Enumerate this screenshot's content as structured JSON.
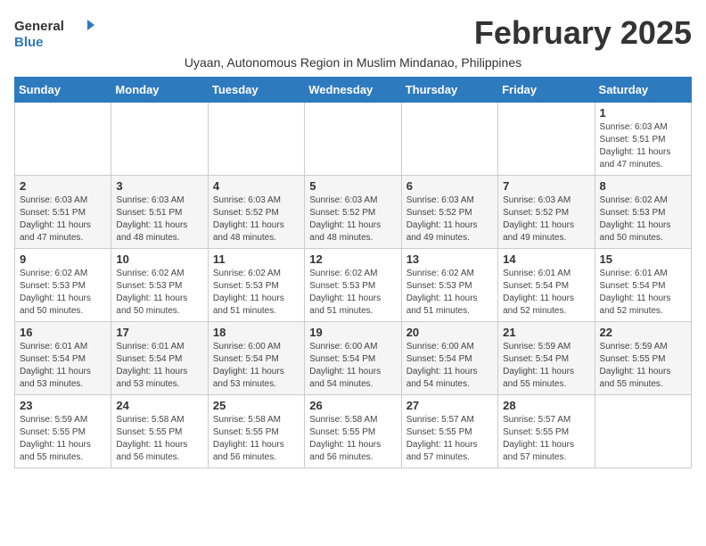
{
  "header": {
    "logo_general": "General",
    "logo_blue": "Blue",
    "month_title": "February 2025",
    "subtitle": "Uyaan, Autonomous Region in Muslim Mindanao, Philippines"
  },
  "weekdays": [
    "Sunday",
    "Monday",
    "Tuesday",
    "Wednesday",
    "Thursday",
    "Friday",
    "Saturday"
  ],
  "weeks": [
    [
      {
        "day": "",
        "sunrise": "",
        "sunset": "",
        "daylight": ""
      },
      {
        "day": "",
        "sunrise": "",
        "sunset": "",
        "daylight": ""
      },
      {
        "day": "",
        "sunrise": "",
        "sunset": "",
        "daylight": ""
      },
      {
        "day": "",
        "sunrise": "",
        "sunset": "",
        "daylight": ""
      },
      {
        "day": "",
        "sunrise": "",
        "sunset": "",
        "daylight": ""
      },
      {
        "day": "",
        "sunrise": "",
        "sunset": "",
        "daylight": ""
      },
      {
        "day": "1",
        "sunrise": "Sunrise: 6:03 AM",
        "sunset": "Sunset: 5:51 PM",
        "daylight": "Daylight: 11 hours and 47 minutes."
      }
    ],
    [
      {
        "day": "2",
        "sunrise": "Sunrise: 6:03 AM",
        "sunset": "Sunset: 5:51 PM",
        "daylight": "Daylight: 11 hours and 47 minutes."
      },
      {
        "day": "3",
        "sunrise": "Sunrise: 6:03 AM",
        "sunset": "Sunset: 5:51 PM",
        "daylight": "Daylight: 11 hours and 48 minutes."
      },
      {
        "day": "4",
        "sunrise": "Sunrise: 6:03 AM",
        "sunset": "Sunset: 5:52 PM",
        "daylight": "Daylight: 11 hours and 48 minutes."
      },
      {
        "day": "5",
        "sunrise": "Sunrise: 6:03 AM",
        "sunset": "Sunset: 5:52 PM",
        "daylight": "Daylight: 11 hours and 48 minutes."
      },
      {
        "day": "6",
        "sunrise": "Sunrise: 6:03 AM",
        "sunset": "Sunset: 5:52 PM",
        "daylight": "Daylight: 11 hours and 49 minutes."
      },
      {
        "day": "7",
        "sunrise": "Sunrise: 6:03 AM",
        "sunset": "Sunset: 5:52 PM",
        "daylight": "Daylight: 11 hours and 49 minutes."
      },
      {
        "day": "8",
        "sunrise": "Sunrise: 6:02 AM",
        "sunset": "Sunset: 5:53 PM",
        "daylight": "Daylight: 11 hours and 50 minutes."
      }
    ],
    [
      {
        "day": "9",
        "sunrise": "Sunrise: 6:02 AM",
        "sunset": "Sunset: 5:53 PM",
        "daylight": "Daylight: 11 hours and 50 minutes."
      },
      {
        "day": "10",
        "sunrise": "Sunrise: 6:02 AM",
        "sunset": "Sunset: 5:53 PM",
        "daylight": "Daylight: 11 hours and 50 minutes."
      },
      {
        "day": "11",
        "sunrise": "Sunrise: 6:02 AM",
        "sunset": "Sunset: 5:53 PM",
        "daylight": "Daylight: 11 hours and 51 minutes."
      },
      {
        "day": "12",
        "sunrise": "Sunrise: 6:02 AM",
        "sunset": "Sunset: 5:53 PM",
        "daylight": "Daylight: 11 hours and 51 minutes."
      },
      {
        "day": "13",
        "sunrise": "Sunrise: 6:02 AM",
        "sunset": "Sunset: 5:53 PM",
        "daylight": "Daylight: 11 hours and 51 minutes."
      },
      {
        "day": "14",
        "sunrise": "Sunrise: 6:01 AM",
        "sunset": "Sunset: 5:54 PM",
        "daylight": "Daylight: 11 hours and 52 minutes."
      },
      {
        "day": "15",
        "sunrise": "Sunrise: 6:01 AM",
        "sunset": "Sunset: 5:54 PM",
        "daylight": "Daylight: 11 hours and 52 minutes."
      }
    ],
    [
      {
        "day": "16",
        "sunrise": "Sunrise: 6:01 AM",
        "sunset": "Sunset: 5:54 PM",
        "daylight": "Daylight: 11 hours and 53 minutes."
      },
      {
        "day": "17",
        "sunrise": "Sunrise: 6:01 AM",
        "sunset": "Sunset: 5:54 PM",
        "daylight": "Daylight: 11 hours and 53 minutes."
      },
      {
        "day": "18",
        "sunrise": "Sunrise: 6:00 AM",
        "sunset": "Sunset: 5:54 PM",
        "daylight": "Daylight: 11 hours and 53 minutes."
      },
      {
        "day": "19",
        "sunrise": "Sunrise: 6:00 AM",
        "sunset": "Sunset: 5:54 PM",
        "daylight": "Daylight: 11 hours and 54 minutes."
      },
      {
        "day": "20",
        "sunrise": "Sunrise: 6:00 AM",
        "sunset": "Sunset: 5:54 PM",
        "daylight": "Daylight: 11 hours and 54 minutes."
      },
      {
        "day": "21",
        "sunrise": "Sunrise: 5:59 AM",
        "sunset": "Sunset: 5:54 PM",
        "daylight": "Daylight: 11 hours and 55 minutes."
      },
      {
        "day": "22",
        "sunrise": "Sunrise: 5:59 AM",
        "sunset": "Sunset: 5:55 PM",
        "daylight": "Daylight: 11 hours and 55 minutes."
      }
    ],
    [
      {
        "day": "23",
        "sunrise": "Sunrise: 5:59 AM",
        "sunset": "Sunset: 5:55 PM",
        "daylight": "Daylight: 11 hours and 55 minutes."
      },
      {
        "day": "24",
        "sunrise": "Sunrise: 5:58 AM",
        "sunset": "Sunset: 5:55 PM",
        "daylight": "Daylight: 11 hours and 56 minutes."
      },
      {
        "day": "25",
        "sunrise": "Sunrise: 5:58 AM",
        "sunset": "Sunset: 5:55 PM",
        "daylight": "Daylight: 11 hours and 56 minutes."
      },
      {
        "day": "26",
        "sunrise": "Sunrise: 5:58 AM",
        "sunset": "Sunset: 5:55 PM",
        "daylight": "Daylight: 11 hours and 56 minutes."
      },
      {
        "day": "27",
        "sunrise": "Sunrise: 5:57 AM",
        "sunset": "Sunset: 5:55 PM",
        "daylight": "Daylight: 11 hours and 57 minutes."
      },
      {
        "day": "28",
        "sunrise": "Sunrise: 5:57 AM",
        "sunset": "Sunset: 5:55 PM",
        "daylight": "Daylight: 11 hours and 57 minutes."
      },
      {
        "day": "",
        "sunrise": "",
        "sunset": "",
        "daylight": ""
      }
    ]
  ]
}
